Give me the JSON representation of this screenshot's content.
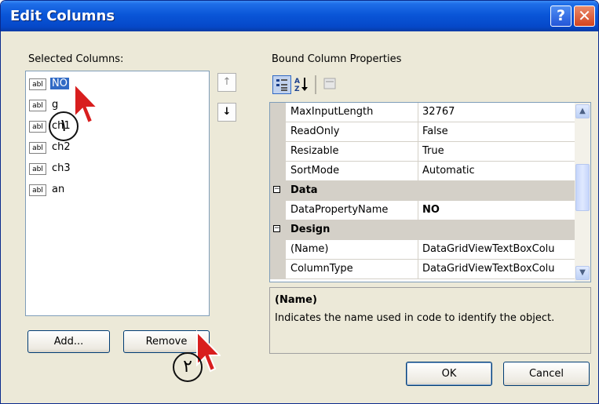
{
  "window": {
    "title": "Edit Columns",
    "help_icon": "?",
    "close_icon": "✕"
  },
  "selected_columns": {
    "label": "Selected Columns:",
    "items": [
      {
        "icon": "abl",
        "name": "NO"
      },
      {
        "icon": "abl",
        "name": "g"
      },
      {
        "icon": "abl",
        "name": "ch1"
      },
      {
        "icon": "abl",
        "name": "ch2"
      },
      {
        "icon": "abl",
        "name": "ch3"
      },
      {
        "icon": "abl",
        "name": "an"
      }
    ],
    "selected_index": 0
  },
  "buttons": {
    "add": "Add...",
    "remove": "Remove",
    "ok": "OK",
    "cancel": "Cancel",
    "move_up": "↑",
    "move_down": "↓"
  },
  "properties": {
    "label": "Bound Column Properties",
    "rows": [
      {
        "name": "MaxInputLength",
        "value": "32767"
      },
      {
        "name": "ReadOnly",
        "value": "False"
      },
      {
        "name": "Resizable",
        "value": "True"
      },
      {
        "name": "SortMode",
        "value": "Automatic"
      },
      {
        "category": "Data"
      },
      {
        "name": "DataPropertyName",
        "value": "NO"
      },
      {
        "category": "Design"
      },
      {
        "name": "(Name)",
        "value": "DataGridViewTextBoxColu"
      },
      {
        "name": "ColumnType",
        "value": "DataGridViewTextBoxColu"
      }
    ]
  },
  "description": {
    "title": "(Name)",
    "text": "Indicates the name used in code to identify the object."
  },
  "annotations": {
    "step1": "١",
    "step2": "٢"
  },
  "colors": {
    "title_bar": "#0a56d8",
    "selection": "#316ac5",
    "dialog_bg": "#ece9d8",
    "cursor_red": "#d81e1e"
  }
}
